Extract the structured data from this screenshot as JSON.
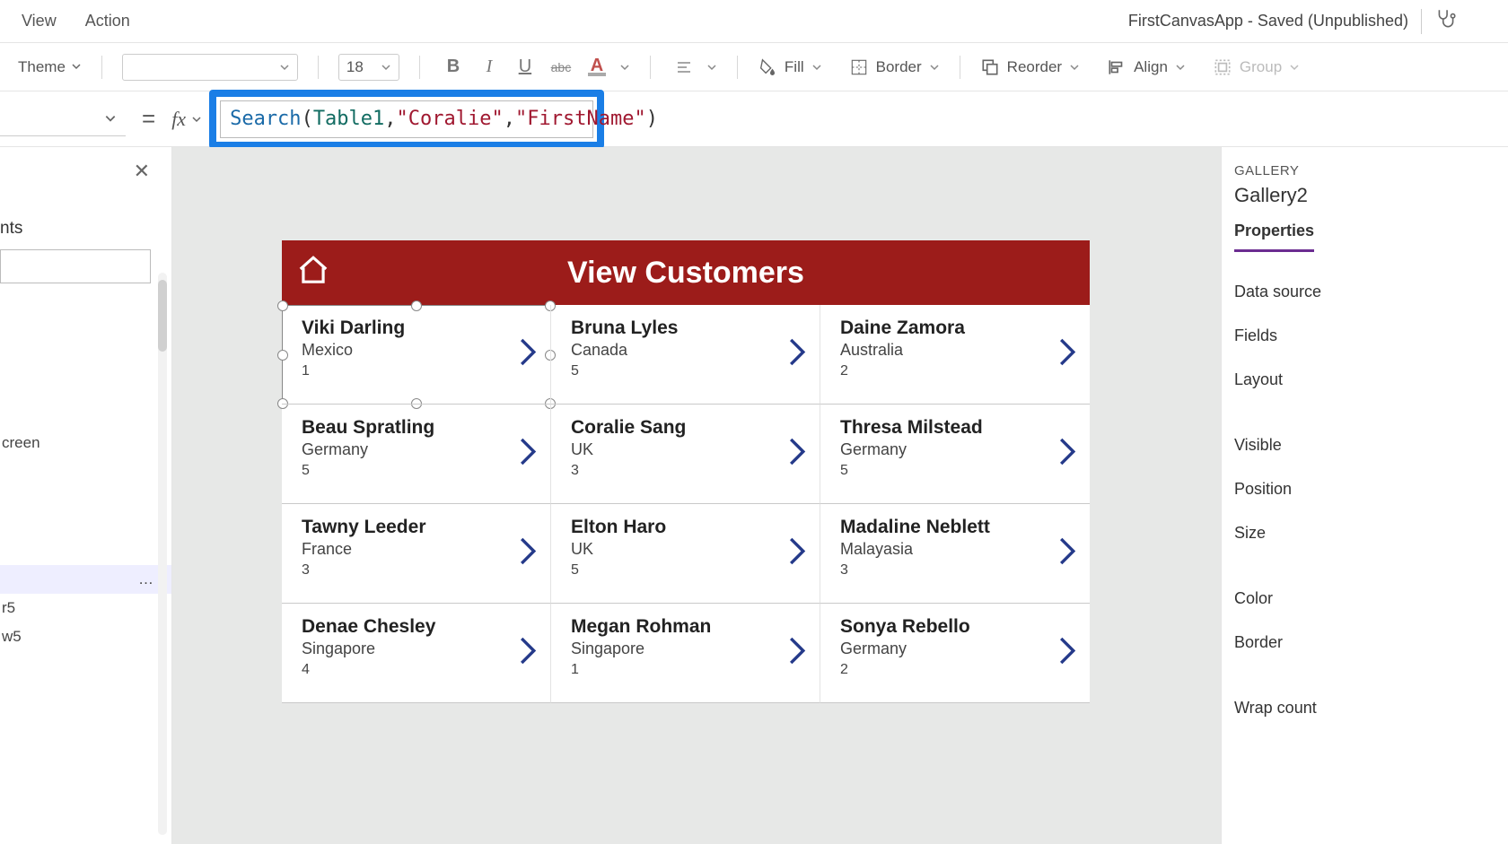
{
  "menubar": {
    "view": "View",
    "action": "Action"
  },
  "app_title": "FirstCanvasApp - Saved (Unpublished)",
  "toolbar": {
    "theme": "Theme",
    "font_name": "",
    "font_size": "18",
    "bold": "B",
    "italic": "I",
    "underline": "U",
    "strike": "abc",
    "fontcolor": "A",
    "fill": "Fill",
    "border": "Border",
    "reorder": "Reorder",
    "align": "Align",
    "group": "Group"
  },
  "formula_bar": {
    "eq": "=",
    "fx": "fx",
    "tokens": {
      "fn": "Search",
      "open": "(",
      "id": "Table1",
      "c1": ", ",
      "q1a": "\"",
      "str1": "Coralie",
      "q1b": "\"",
      "c2": ", ",
      "q2a": "\"",
      "str2": "FirstName",
      "q2b": "\"",
      "close": ")"
    }
  },
  "tree": {
    "header_partial": "nts",
    "screen_partial": "creen",
    "item_r5": "r5",
    "item_w5": "w5"
  },
  "preview": {
    "title": "View Customers",
    "rows": [
      [
        {
          "name": "Viki  Darling",
          "country": "Mexico",
          "num": "1"
        },
        {
          "name": "Bruna  Lyles",
          "country": "Canada",
          "num": "5"
        },
        {
          "name": "Daine  Zamora",
          "country": "Australia",
          "num": "2"
        }
      ],
      [
        {
          "name": "Beau  Spratling",
          "country": "Germany",
          "num": "5"
        },
        {
          "name": "Coralie  Sang",
          "country": "UK",
          "num": "3"
        },
        {
          "name": "Thresa  Milstead",
          "country": "Germany",
          "num": "5"
        }
      ],
      [
        {
          "name": "Tawny  Leeder",
          "country": "France",
          "num": "3"
        },
        {
          "name": "Elton  Haro",
          "country": "UK",
          "num": "5"
        },
        {
          "name": "Madaline  Neblett",
          "country": "Malayasia",
          "num": "3"
        }
      ],
      [
        {
          "name": "Denae  Chesley",
          "country": "Singapore",
          "num": "4"
        },
        {
          "name": "Megan  Rohman",
          "country": "Singapore",
          "num": "1"
        },
        {
          "name": "Sonya  Rebello",
          "country": "Germany",
          "num": "2"
        }
      ]
    ]
  },
  "right_pane": {
    "section": "GALLERY",
    "name": "Gallery2",
    "tab": "Properties",
    "items": {
      "datasource": "Data source",
      "fields": "Fields",
      "layout": "Layout",
      "visible": "Visible",
      "position": "Position",
      "size": "Size",
      "color": "Color",
      "border": "Border",
      "wrap": "Wrap count"
    }
  }
}
